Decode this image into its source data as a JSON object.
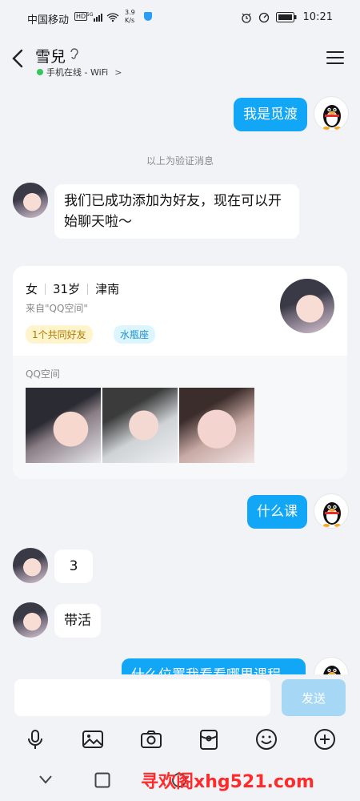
{
  "status_bar": {
    "carrier": "中国移动",
    "hd": "HD",
    "net": "5G",
    "speed_value": "3.9",
    "speed_unit": "K/s",
    "time": "10:21"
  },
  "header": {
    "title": "雪兒",
    "subtitle": "手机在线 - WiFi",
    "subtitle_arrow": ">"
  },
  "messages": [
    {
      "side": "out",
      "text": "我是觅渡"
    },
    {
      "side": "system",
      "text": "以上为验证消息"
    },
    {
      "side": "in",
      "text": "我们已成功添加为好友，现在可以开始聊天啦～"
    }
  ],
  "profile_card": {
    "gender": "女",
    "age": "31岁",
    "location": "津南",
    "from": "来自\"QQ空间\"",
    "tag_friends": "1个共同好友",
    "tag_zodiac": "水瓶座",
    "qzone_label": "QQ空间"
  },
  "messages2": [
    {
      "side": "out",
      "text": "什么课"
    },
    {
      "side": "in",
      "text": "3"
    },
    {
      "side": "in",
      "text": "带活"
    },
    {
      "side": "out",
      "text": "什么位置我看看哪里课程"
    }
  ],
  "input": {
    "placeholder": "",
    "send_label": "发送"
  },
  "toolbar": {
    "icons": [
      "microphone-icon",
      "image-icon",
      "camera-icon",
      "red-packet-icon",
      "emoji-icon",
      "plus-icon"
    ]
  },
  "watermark": "寻欢阁xhg521.com",
  "colors": {
    "accent": "#12a6f6",
    "send_disabled": "#a6d8f6",
    "online": "#35c759",
    "watermark": "#ff2b2b"
  }
}
